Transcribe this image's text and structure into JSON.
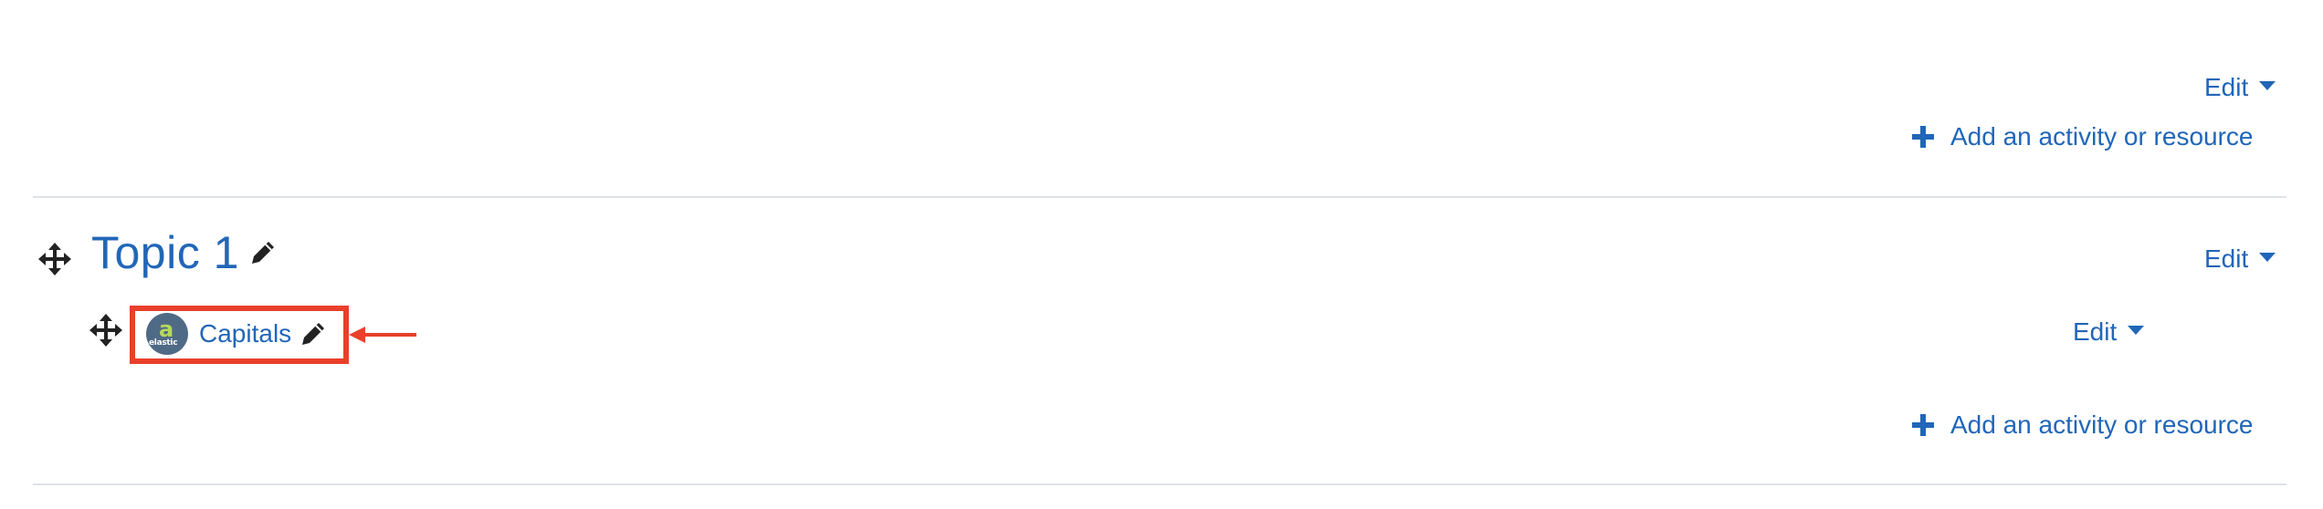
{
  "colors": {
    "link": "#2166b8",
    "divider": "#dee2e6",
    "highlight": "#e8402a",
    "icon_dark": "#222222"
  },
  "section_0": {
    "edit_label": "Edit",
    "add_activity_label": "Add an activity or resource"
  },
  "section_1": {
    "title": "Topic 1",
    "edit_label": "Edit",
    "add_activity_label": "Add an activity or resource",
    "activities": [
      {
        "name": "Capitals",
        "icon_text_big": "a",
        "icon_text_small": "elastic",
        "edit_label": "Edit"
      }
    ]
  },
  "icons": {
    "move": "move-icon",
    "pencil": "pencil-icon",
    "plus": "plus-icon",
    "caret": "caret-down-icon",
    "arrow": "arrow-left-icon"
  }
}
